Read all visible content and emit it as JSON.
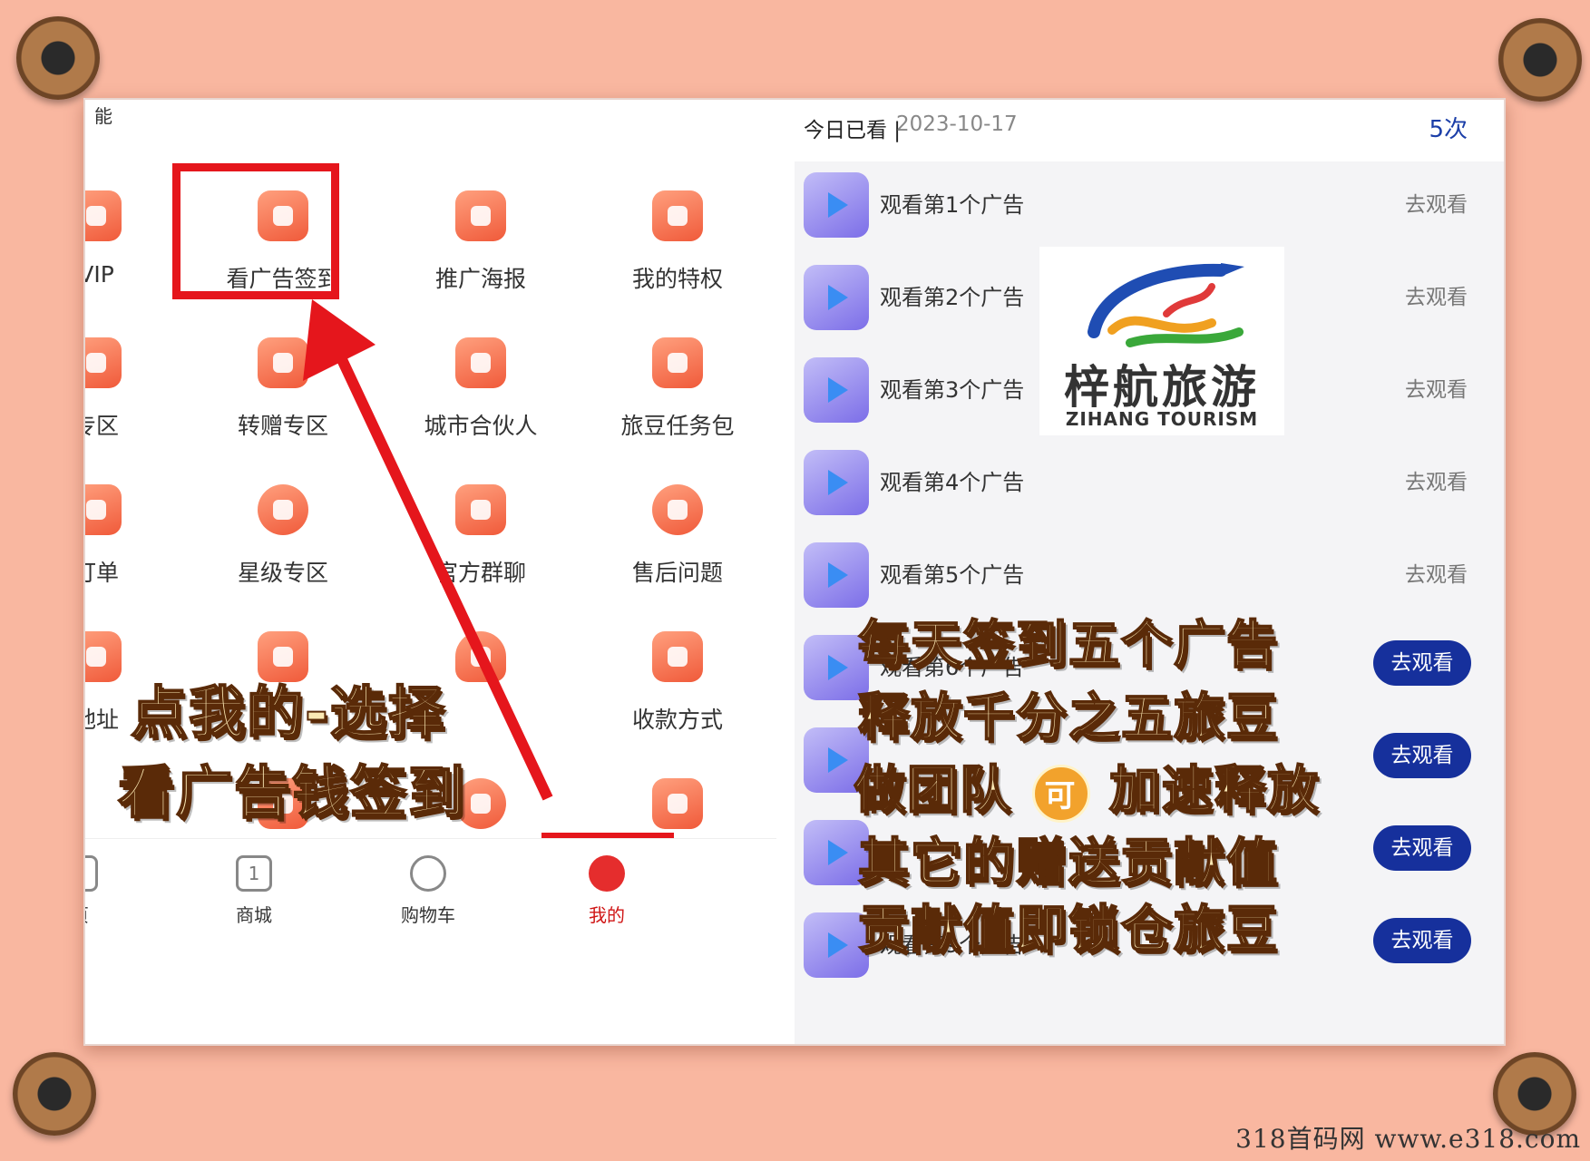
{
  "left_panel": {
    "top_cut_text": "能",
    "grid": [
      {
        "label": "VIP"
      },
      {
        "label": "看广告签到"
      },
      {
        "label": "推广海报"
      },
      {
        "label": "我的特权"
      },
      {
        "label": "专区"
      },
      {
        "label": "转赠专区"
      },
      {
        "label": "城市合伙人"
      },
      {
        "label": "旅豆任务包"
      },
      {
        "label": "订单"
      },
      {
        "label": "星级专区"
      },
      {
        "label": "官方群聊"
      },
      {
        "label": "售后问题"
      },
      {
        "label": "地址"
      },
      {
        "label": ""
      },
      {
        "label": ""
      },
      {
        "label": "收款方式"
      }
    ],
    "bottom_nav": [
      {
        "label": "页"
      },
      {
        "label": "商城"
      },
      {
        "label": "购物车"
      },
      {
        "label": "我的"
      }
    ],
    "calendar_number": "1",
    "overlay_line1": "点我的-选择",
    "overlay_line2": "看广告钱签到"
  },
  "right_panel": {
    "header_label": "今日已看 |",
    "header_date": "2023-10-17",
    "count": "5次",
    "ads": [
      {
        "title": "观看第1个广告",
        "action": "去观看"
      },
      {
        "title": "观看第2个广告",
        "action": "去观看"
      },
      {
        "title": "观看第3个广告",
        "action": "去观看"
      },
      {
        "title": "观看第4个广告",
        "action": "去观看"
      },
      {
        "title": "观看第5个广告",
        "action": "去观看"
      },
      {
        "title": "观看第6个广告",
        "action": "去观看"
      },
      {
        "title": "",
        "action": "去观看"
      },
      {
        "title": "",
        "action": "去观看"
      },
      {
        "title": "观看第9个广告",
        "action": "去观看"
      }
    ],
    "logo_cn": "梓航旅游",
    "logo_en": "ZIHANG TOURISM",
    "overlay_lines": [
      "每天签到五个广告",
      "释放千分之五旅豆",
      "做团队",
      "加速释放",
      "其它的赠送贡献值",
      "贡献值即锁仓旅豆"
    ],
    "badge": "可"
  },
  "watermark": "318首码网  www.e318.com",
  "colors": {
    "background": "#f9b7a0",
    "highlight": "#e5161c",
    "button": "#16309c",
    "icon_orange": "#f05a3a"
  }
}
